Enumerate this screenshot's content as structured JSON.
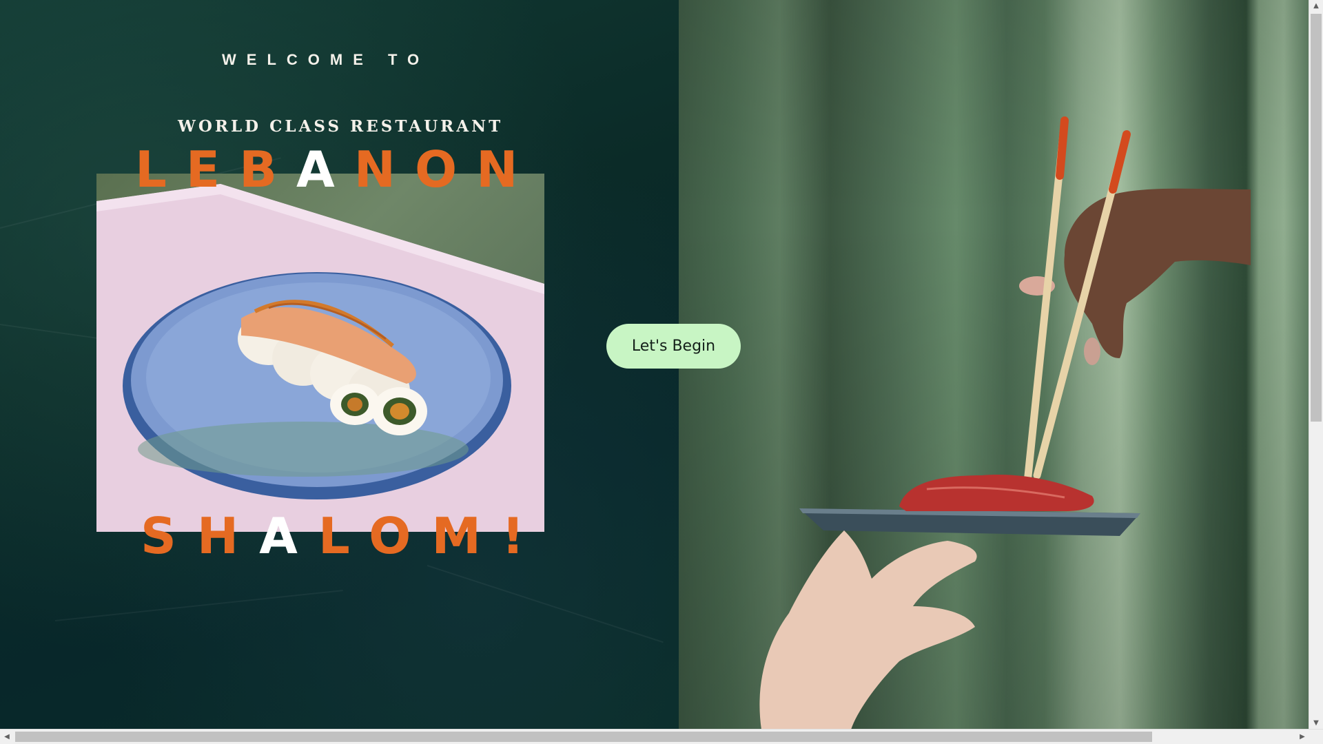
{
  "hero": {
    "welcome": "WELCOME TO",
    "tagline": "WORLD CLASS RESTAURANT",
    "headline_top": [
      "LEB",
      "A",
      "NON"
    ],
    "headline_bottom": [
      "SH",
      "A",
      "LOM!"
    ],
    "cta_label": "Let's Begin"
  },
  "colors": {
    "panel_bg": "#0b2a26",
    "accent_orange": "#e56a22",
    "highlight_white": "#ffffff",
    "cta_bg": "#c8f5c4"
  },
  "icons": {
    "scroll_up": "▲",
    "scroll_down": "▼",
    "scroll_left": "◀",
    "scroll_right": "▶"
  }
}
